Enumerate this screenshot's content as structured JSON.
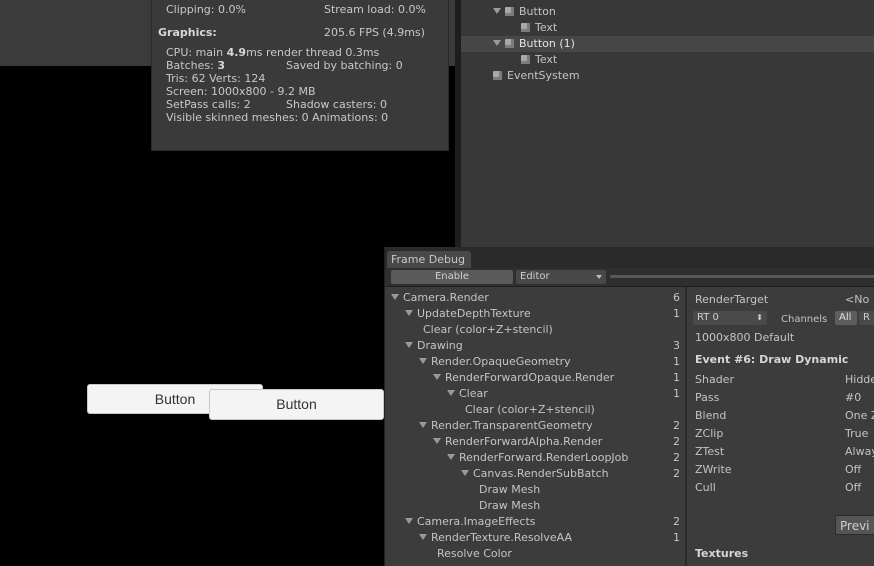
{
  "stats": {
    "cut_left": "Clipping: 0.0%",
    "cut_right": "Stream load: 0.0%",
    "graphics_label": "Graphics:",
    "fps": "205.6 FPS (4.9ms)",
    "cpu_prefix": "CPU: main ",
    "cpu_main": "4.9",
    "cpu_suffix": "ms  render thread 0.3ms",
    "batches_prefix": "Batches: ",
    "batches": "3",
    "saved": "Saved by batching: 0",
    "tris": "Tris: 62   Verts: 124",
    "screen": "Screen: 1000x800 - 9.2 MB",
    "setpass": "SetPass calls: 2",
    "shadow": "Shadow casters: 0",
    "skinned": "Visible skinned meshes: 0  Animations: 0"
  },
  "hierarchy": {
    "items": [
      {
        "label": "Button",
        "level": 1,
        "expanded": true,
        "selected": false
      },
      {
        "label": "Text",
        "level": 2,
        "expanded": false,
        "selected": false
      },
      {
        "label": "Button (1)",
        "level": 1,
        "expanded": true,
        "selected": true
      },
      {
        "label": "Text",
        "level": 2,
        "expanded": false,
        "selected": false
      },
      {
        "label": "EventSystem",
        "level": 0,
        "expanded": false,
        "selected": false
      }
    ]
  },
  "game": {
    "button1": "Button",
    "button2": "Button"
  },
  "frame_debug": {
    "tab": "Frame Debug",
    "enable": "Enable",
    "mode": "Editor",
    "tree": [
      {
        "label": "Camera.Render",
        "indent": 0,
        "arrow": true,
        "count": "6"
      },
      {
        "label": "UpdateDepthTexture",
        "indent": 1,
        "arrow": true,
        "count": "1"
      },
      {
        "label": "Clear (color+Z+stencil)",
        "indent": 2,
        "arrow": false,
        "count": ""
      },
      {
        "label": "Drawing",
        "indent": 1,
        "arrow": true,
        "count": "3"
      },
      {
        "label": "Render.OpaqueGeometry",
        "indent": 2,
        "arrow": true,
        "count": "1"
      },
      {
        "label": "RenderForwardOpaque.Render",
        "indent": 3,
        "arrow": true,
        "count": "1"
      },
      {
        "label": "Clear",
        "indent": 4,
        "arrow": true,
        "count": "1"
      },
      {
        "label": "Clear (color+Z+stencil)",
        "indent": 5,
        "arrow": false,
        "count": ""
      },
      {
        "label": "Render.TransparentGeometry",
        "indent": 2,
        "arrow": true,
        "count": "2"
      },
      {
        "label": "RenderForwardAlpha.Render",
        "indent": 3,
        "arrow": true,
        "count": "2"
      },
      {
        "label": "RenderForward.RenderLoopJob",
        "indent": 4,
        "arrow": true,
        "count": "2"
      },
      {
        "label": "Canvas.RenderSubBatch",
        "indent": 5,
        "arrow": true,
        "count": "2"
      },
      {
        "label": "Draw Mesh",
        "indent": 6,
        "arrow": false,
        "count": ""
      },
      {
        "label": "Draw Mesh",
        "indent": 6,
        "arrow": false,
        "count": ""
      },
      {
        "label": "Camera.ImageEffects",
        "indent": 1,
        "arrow": true,
        "count": "2"
      },
      {
        "label": "RenderTexture.ResolveAA",
        "indent": 2,
        "arrow": true,
        "count": "1"
      },
      {
        "label": "Resolve Color",
        "indent": 3,
        "arrow": false,
        "count": ""
      }
    ],
    "detail": {
      "render_target_label": "RenderTarget",
      "render_target_value": "<No",
      "rt_select": "RT 0",
      "channels_label": "Channels",
      "channels_all": "All",
      "channels_r": "R",
      "resolution": "1000x800 Default",
      "event_title": "Event #6: Draw Dynamic",
      "props": [
        {
          "name": "Shader",
          "value": "Hidde"
        },
        {
          "name": "Pass",
          "value": "#0"
        },
        {
          "name": "Blend",
          "value": "One Z"
        },
        {
          "name": "ZClip",
          "value": "True"
        },
        {
          "name": "ZTest",
          "value": "Alway"
        },
        {
          "name": "ZWrite",
          "value": "Off"
        },
        {
          "name": "Cull",
          "value": "Off"
        }
      ],
      "preview_button": "Previ",
      "textures_label": "Textures"
    }
  }
}
